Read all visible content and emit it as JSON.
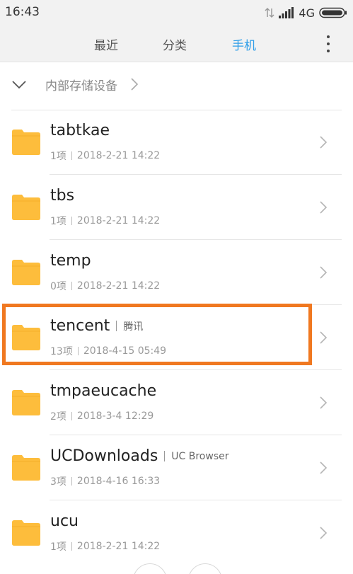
{
  "status_bar": {
    "time": "16:43",
    "network": "4G"
  },
  "tabs": [
    {
      "label": "最近",
      "active": false
    },
    {
      "label": "分类",
      "active": false
    },
    {
      "label": "手机",
      "active": true
    }
  ],
  "path_bar": {
    "label": "内部存储设备"
  },
  "files": [
    {
      "name": "tabtkae",
      "alias": "",
      "count": "1项",
      "date": "2018-2-21 14:22"
    },
    {
      "name": "tbs",
      "alias": "",
      "count": "1项",
      "date": "2018-2-21 14:22"
    },
    {
      "name": "temp",
      "alias": "",
      "count": "0项",
      "date": "2018-2-21 14:22"
    },
    {
      "name": "tencent",
      "alias": "腾讯",
      "count": "13项",
      "date": "2018-4-15 05:49"
    },
    {
      "name": "tmpaeucache",
      "alias": "",
      "count": "2项",
      "date": "2018-3-4 12:29"
    },
    {
      "name": "UCDownloads",
      "alias": "UC Browser",
      "count": "3项",
      "date": "2018-4-16 16:33"
    },
    {
      "name": "ucu",
      "alias": "",
      "count": "1项",
      "date": "2018-2-21 14:22"
    }
  ],
  "colors": {
    "accent": "#2f9ee8",
    "folder": "#fdbd3c",
    "highlight": "#f07820"
  },
  "icons": {
    "folder": "folder-icon",
    "chevron": "chevron-right-icon",
    "more": "more-vertical-icon"
  }
}
